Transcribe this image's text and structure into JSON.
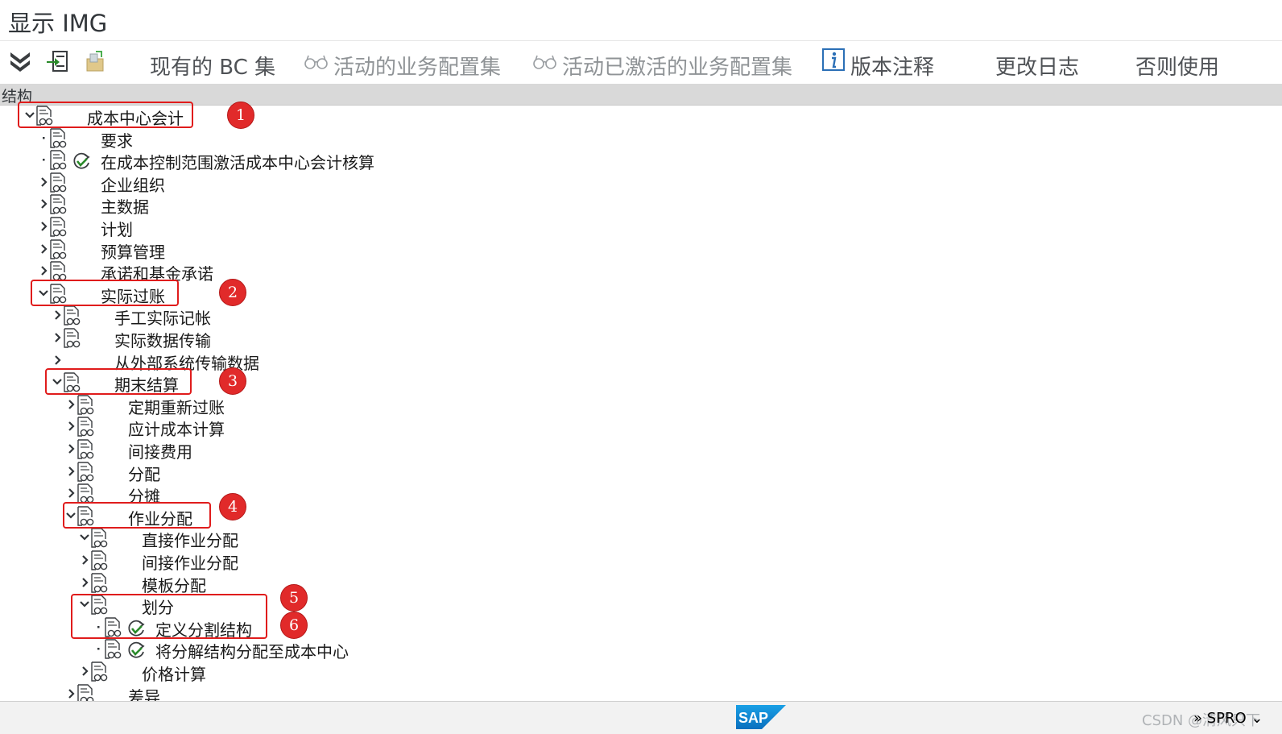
{
  "title": "显示 IMG",
  "toolbar": {
    "existing_bc_sets": "现有的 BC 集",
    "active_bc_sets": "活动的业务配置集",
    "activated_bc_sets": "活动已激活的业务配置集",
    "release_notes": "版本注释",
    "change_log": "更改日志",
    "where_used": "否则使用"
  },
  "structure_label": "结构",
  "tree": [
    {
      "label": "成本中心会计",
      "level": 0,
      "expander": "open",
      "doc": true,
      "activity": false
    },
    {
      "label": "要求",
      "level": 1,
      "expander": "leaf",
      "doc": true,
      "activity": false
    },
    {
      "label": "在成本控制范围激活成本中心会计核算",
      "level": 1,
      "expander": "leaf",
      "doc": true,
      "activity": true
    },
    {
      "label": "企业组织",
      "level": 1,
      "expander": "closed",
      "doc": true,
      "activity": false
    },
    {
      "label": "主数据",
      "level": 1,
      "expander": "closed",
      "doc": true,
      "activity": false
    },
    {
      "label": "计划",
      "level": 1,
      "expander": "closed",
      "doc": true,
      "activity": false
    },
    {
      "label": "预算管理",
      "level": 1,
      "expander": "closed",
      "doc": true,
      "activity": false
    },
    {
      "label": "承诺和基金承诺",
      "level": 1,
      "expander": "closed",
      "doc": true,
      "activity": false
    },
    {
      "label": "实际过账",
      "level": 1,
      "expander": "open",
      "doc": true,
      "activity": false
    },
    {
      "label": "手工实际记帐",
      "level": 2,
      "expander": "closed",
      "doc": true,
      "activity": false
    },
    {
      "label": "实际数据传输",
      "level": 2,
      "expander": "closed",
      "doc": true,
      "activity": false
    },
    {
      "label": "从外部系统传输数据",
      "level": 2,
      "expander": "closed",
      "doc": false,
      "activity": false
    },
    {
      "label": "期末结算",
      "level": 2,
      "expander": "open",
      "doc": true,
      "activity": false
    },
    {
      "label": "定期重新过账",
      "level": 3,
      "expander": "closed",
      "doc": true,
      "activity": false
    },
    {
      "label": "应计成本计算",
      "level": 3,
      "expander": "closed",
      "doc": true,
      "activity": false
    },
    {
      "label": "间接费用",
      "level": 3,
      "expander": "closed",
      "doc": true,
      "activity": false
    },
    {
      "label": "分配",
      "level": 3,
      "expander": "closed",
      "doc": true,
      "activity": false
    },
    {
      "label": "分摊",
      "level": 3,
      "expander": "closed",
      "doc": true,
      "activity": false
    },
    {
      "label": "作业分配",
      "level": 3,
      "expander": "open",
      "doc": true,
      "activity": false
    },
    {
      "label": "直接作业分配",
      "level": 4,
      "expander": "open",
      "doc": true,
      "activity": false
    },
    {
      "label": "间接作业分配",
      "level": 4,
      "expander": "closed",
      "doc": true,
      "activity": false
    },
    {
      "label": "模板分配",
      "level": 4,
      "expander": "closed",
      "doc": true,
      "activity": false
    },
    {
      "label": "划分",
      "level": 4,
      "expander": "open",
      "doc": true,
      "activity": false
    },
    {
      "label": "定义分割结构",
      "level": 5,
      "expander": "leaf",
      "doc": true,
      "activity": true
    },
    {
      "label": "将分解结构分配至成本中心",
      "level": 5,
      "expander": "leaf",
      "doc": true,
      "activity": true
    },
    {
      "label": "价格计算",
      "level": 4,
      "expander": "closed",
      "doc": true,
      "activity": false
    },
    {
      "label": "差异",
      "level": 3,
      "expander": "closed",
      "doc": true,
      "activity": false
    }
  ],
  "annotations": [
    "1",
    "2",
    "3",
    "4",
    "5",
    "6"
  ],
  "status": {
    "sap_logo": "SAP",
    "watermark": "CSDN @清风只下",
    "tcode": "» SPRO ⌄"
  },
  "colors": {
    "highlight": "#e01c1c",
    "badge": "#e12a2a",
    "check": "#2a8a2a"
  }
}
